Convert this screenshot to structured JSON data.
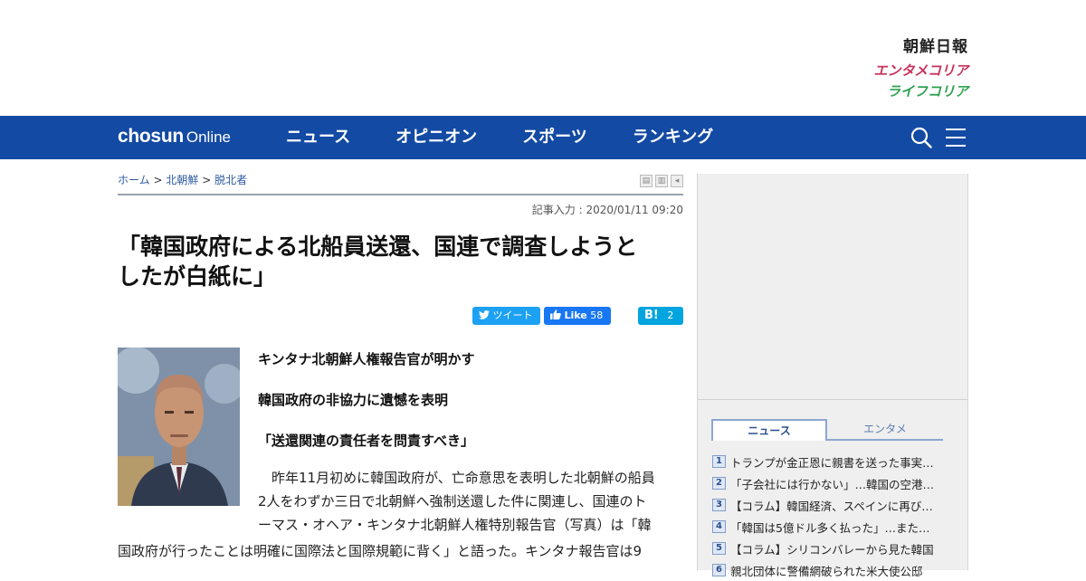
{
  "brands": {
    "chosun_nippo": "朝鮮日報",
    "enta_korea": "エンタメコリア",
    "life_korea": "ライフコリア"
  },
  "nav": {
    "logo_main": "chosun",
    "logo_sub": "Online",
    "items": [
      "ニュース",
      "オピニオン",
      "スポーツ",
      "ランキング"
    ],
    "icons": [
      "search-icon",
      "menu-icon"
    ]
  },
  "breadcrumb": {
    "home": "ホーム",
    "sep": ">",
    "level1": "北朝鮮",
    "level2": "脱北者"
  },
  "article": {
    "dateline": "記事入力 : 2020/01/11 09:20",
    "headline_line1": "「韓国政府による北船員送還、国連で調査しようと",
    "headline_line2": "したが白紙に」",
    "share": {
      "tweet_label": "ツイート",
      "like_label": "Like",
      "like_count": "58",
      "hatena_label": "B!",
      "hatena_count": "2"
    },
    "subheads": [
      "キンタナ北朝鮮人権報告官が明かす",
      "韓国政府の非協力に遺憾を表明",
      "「送還関連の責任者を問責すべき」"
    ],
    "body_line1": "　昨年11月初めに韓国政府が、亡命意思を表明した北朝鮮の船員",
    "body_line2": "2人をわずか三日で北朝鮮へ強制送還した件に関連し、国連のト",
    "body_line3": "ーマス・オヘア・キンタナ北朝鮮人権特別報告官（写真）は「韓",
    "body_line4": "国政府が行ったことは明確に国際法と国際規範に背く」と語った。キンタナ報告官は9"
  },
  "ranking": {
    "tab_news": "ニュース",
    "tab_enta": "エンタメ",
    "items": [
      {
        "num": "1",
        "text": "トランプが金正恩に親書を送った事実…"
      },
      {
        "num": "2",
        "text": "「子会社には行かない」…韓国の空港…"
      },
      {
        "num": "3",
        "text": "【コラム】韓国経済、スペインに再び…"
      },
      {
        "num": "4",
        "text": "「韓国は5億ドル多く払った」…また…"
      },
      {
        "num": "5",
        "text": "【コラム】シリコンバレーから見た韓国"
      },
      {
        "num": "6",
        "text": "親北団体に警備網破られた米大使公邸"
      }
    ]
  },
  "colors": {
    "nav_bg": "#134aa3",
    "enta_pink": "#c8325a",
    "life_green": "#2fa14f",
    "twitter": "#1da1f2",
    "facebook": "#1877f2",
    "hatena": "#00a4de"
  }
}
